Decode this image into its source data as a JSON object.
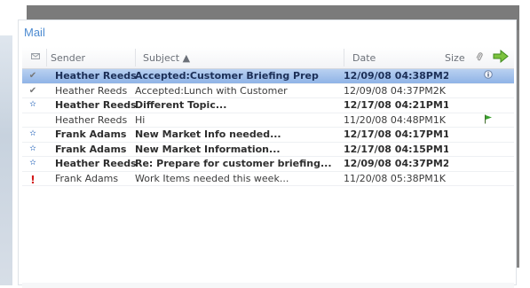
{
  "window": {
    "title": "Mail"
  },
  "columns": {
    "sender": "Sender",
    "subject": "Subject ▲",
    "date": "Date",
    "size": "Size"
  },
  "icons": {
    "header_envelope": "envelope-icon",
    "header_attachment": "paperclip-icon",
    "header_action": "green-arrow-icon"
  },
  "messages": [
    {
      "sender": "Heather Reeds",
      "subject": "Accepted:Customer Briefing Prep",
      "date": "12/09/08 04:38PM",
      "size": "2K",
      "icon": "check-icon",
      "flag": "info-icon",
      "bold": true,
      "selected": true
    },
    {
      "sender": "Heather Reeds",
      "subject": "Accepted:Lunch with Customer",
      "date": "12/09/08 04:37PM",
      "size": "2K",
      "icon": "check-icon",
      "flag": "",
      "bold": false,
      "selected": false
    },
    {
      "sender": "Heather Reeds",
      "subject": "Different Topic...",
      "date": "12/17/08 04:21PM",
      "size": "1K",
      "icon": "star-icon",
      "flag": "",
      "bold": true,
      "selected": false
    },
    {
      "sender": "Heather Reeds",
      "subject": "Hi",
      "date": "11/20/08 04:48PM",
      "size": "1K",
      "icon": "",
      "flag": "green-flag-icon",
      "bold": false,
      "selected": false
    },
    {
      "sender": "Frank Adams",
      "subject": "New Market Info needed...",
      "date": "12/17/08 04:17PM",
      "size": "1K",
      "icon": "star-icon",
      "flag": "",
      "bold": true,
      "selected": false
    },
    {
      "sender": "Frank Adams",
      "subject": "New Market Information...",
      "date": "12/17/08 04:15PM",
      "size": "1K",
      "icon": "star-icon",
      "flag": "",
      "bold": true,
      "selected": false
    },
    {
      "sender": "Heather Reeds",
      "subject": "Re: Prepare for customer briefing...",
      "date": "12/09/08 04:37PM",
      "size": "2K",
      "icon": "star-icon",
      "flag": "",
      "bold": true,
      "selected": false
    },
    {
      "sender": "Frank Adams",
      "subject": "Work Items needed this week...",
      "date": "11/20/08 05:38PM",
      "size": "1K",
      "icon": "exclamation-icon",
      "flag": "",
      "bold": false,
      "selected": false
    }
  ],
  "colors": {
    "title": "#4d8bd1",
    "selected_row": "#8fb3e6",
    "shadow": "#7b7b7b",
    "flag": "#3aa12f",
    "urgent": "#d31a1a"
  }
}
